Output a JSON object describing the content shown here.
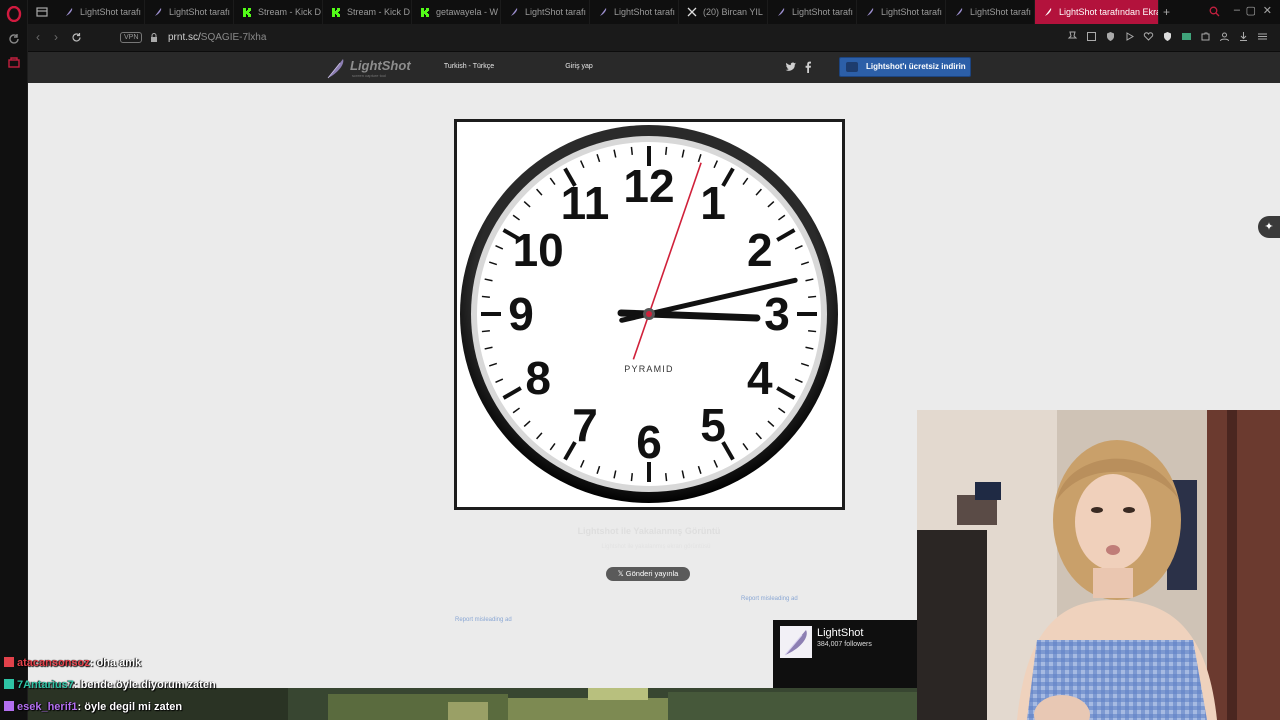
{
  "browser": {
    "tabs": [
      {
        "label": "LightShot tarafı",
        "favicon": "feather-icon"
      },
      {
        "label": "LightShot tarafı",
        "favicon": "feather-icon"
      },
      {
        "label": "Stream - Kick D",
        "favicon": "kick-icon"
      },
      {
        "label": "Stream - Kick D",
        "favicon": "kick-icon"
      },
      {
        "label": "getawayela - W",
        "favicon": "kick-icon"
      },
      {
        "label": "LightShot tarafı",
        "favicon": "feather-icon"
      },
      {
        "label": "LightShot tarafı",
        "favicon": "feather-icon"
      },
      {
        "label": "(20) Bircan YIL",
        "favicon": "x-icon"
      },
      {
        "label": "LightShot tarafı",
        "favicon": "feather-icon"
      },
      {
        "label": "LightShot tarafı",
        "favicon": "feather-icon"
      },
      {
        "label": "LightShot tarafı",
        "favicon": "feather-icon"
      }
    ],
    "active_tab": "LightShot tarafından Ekran",
    "new_tab": "+",
    "vpn_label": "VPN",
    "url_host": "prnt.sc/",
    "url_path": "SQAGIE-7lxha",
    "accent": "#b3123c"
  },
  "lightshot": {
    "logo": "LightShot",
    "logo_tagline": "screen capture tool",
    "language": "Turkish - Türkçe",
    "login": "Giriş yap",
    "social": [
      "twitter-icon",
      "facebook-icon"
    ],
    "download_button": "Lightshot'ı ücretsiz indirin",
    "caption_title": "Lightshot ile Yakalanmış Görüntü",
    "caption_sub": "Lightshot ile yakalanmış ekran görüntüsü",
    "tweet_button": "𝕏  Gönderi yayınla",
    "report_ad": "Report misleading ad",
    "brand_color": "#2c5fa8"
  },
  "clock": {
    "brand": "PYRAMID",
    "numbers": [
      "12",
      "1",
      "2",
      "3",
      "4",
      "5",
      "6",
      "7",
      "8",
      "9",
      "10",
      "11"
    ],
    "hour": 3.07,
    "minute": 7,
    "second": 2
  },
  "kick_alert": {
    "name": "LightShot",
    "followers": "384,007 followers"
  },
  "chat": [
    {
      "user": "atacansonsoz",
      "msg": ": oha amk",
      "color": "#e2424b"
    },
    {
      "user": "7Antarius7",
      "msg": ": bende öyle diyorum zaten",
      "color": "#2ec4a5"
    },
    {
      "user": "esek_herif1",
      "msg": ": öyle degil mi zaten",
      "color": "#b36ff0"
    }
  ]
}
